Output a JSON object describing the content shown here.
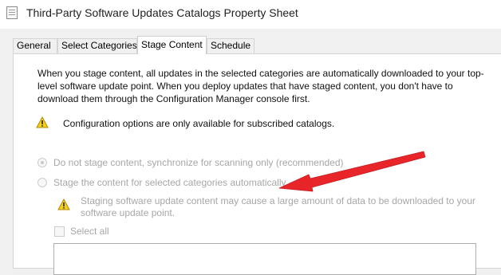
{
  "window": {
    "title": "Third-Party Software Updates Catalogs Property Sheet",
    "icon": "property-sheet-icon"
  },
  "tabs": [
    {
      "label": "General",
      "active": false
    },
    {
      "label": "Select Categories",
      "active": false
    },
    {
      "label": "Stage Content",
      "active": true
    },
    {
      "label": "Schedule",
      "active": false
    }
  ],
  "content": {
    "description": "When you stage content, all updates in the selected categories are automatically downloaded to your top-level software update point. When you deploy updates that have staged content, you don't have to download them through the Configuration Manager console first.",
    "info_message": "Configuration options are only available for subscribed catalogs.",
    "options": [
      {
        "label": "Do not stage content, synchronize for scanning only (recommended)",
        "checked": true,
        "enabled": false
      },
      {
        "label": "Stage the content for selected categories automatically",
        "checked": false,
        "enabled": false
      }
    ],
    "staging_warning": "Staging software update content may cause a large amount of data to be downloaded to your software update point.",
    "select_all_label": "Select all",
    "select_all_checked": false
  },
  "colors": {
    "warning_yellow": "#f7d117",
    "arrow_red": "#e8262a",
    "disabled_text": "#a7a7a7"
  }
}
